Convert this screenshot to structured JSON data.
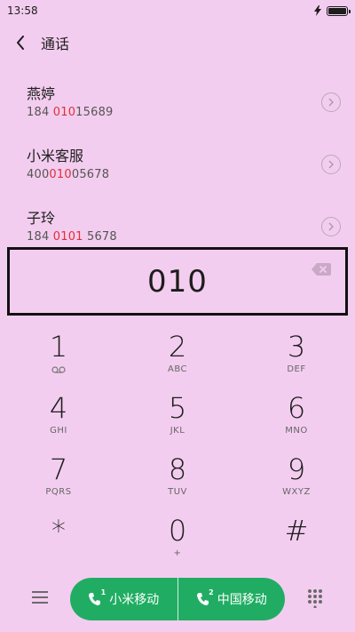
{
  "status": {
    "time": "13:58"
  },
  "header": {
    "title": "通话"
  },
  "contacts": [
    {
      "name": "燕婷",
      "number_parts": [
        "184 ",
        "010",
        "15689"
      ]
    },
    {
      "name": "小米客服",
      "number_parts": [
        "400",
        "010",
        "05678"
      ]
    },
    {
      "name": "子玲",
      "number_parts": [
        "184 ",
        "0101",
        " 5678"
      ]
    }
  ],
  "dialer": {
    "number": "010"
  },
  "keypad": [
    {
      "digit": "1",
      "letters": ""
    },
    {
      "digit": "2",
      "letters": "ABC"
    },
    {
      "digit": "3",
      "letters": "DEF"
    },
    {
      "digit": "4",
      "letters": "GHI"
    },
    {
      "digit": "5",
      "letters": "JKL"
    },
    {
      "digit": "6",
      "letters": "MNO"
    },
    {
      "digit": "7",
      "letters": "PQRS"
    },
    {
      "digit": "8",
      "letters": "TUV"
    },
    {
      "digit": "9",
      "letters": "WXYZ"
    },
    {
      "digit": "*",
      "letters": ""
    },
    {
      "digit": "0",
      "letters": "+"
    },
    {
      "digit": "#",
      "letters": ""
    }
  ],
  "call_buttons": {
    "sim1_label": "小米移动",
    "sim1_number": "1",
    "sim2_label": "中国移动",
    "sim2_number": "2"
  },
  "colors": {
    "background": "#f3cdef",
    "highlight": "#e0303a",
    "call_green": "#20ad63"
  },
  "icons": {
    "status": [
      "lightning-icon",
      "battery-icon"
    ],
    "header": "back-arrow-icon",
    "contact_detail": "chevron-right-circle-icon",
    "dialer": "backspace-icon",
    "key_1": "voicemail-icon",
    "bottom": [
      "menu-icon",
      "phone-icon",
      "dialpad-toggle-icon"
    ]
  }
}
